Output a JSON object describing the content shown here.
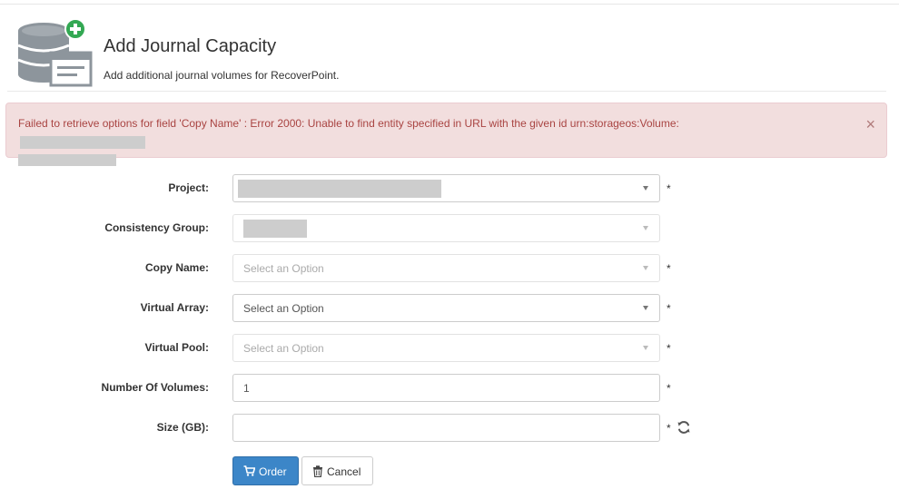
{
  "header": {
    "title": "Add Journal Capacity",
    "subtitle": "Add additional journal volumes for RecoverPoint.",
    "icon": "storage-add-icon"
  },
  "alert": {
    "message_part1": "Failed to retrieve options for field 'Copy Name' : Error 2000: Unable to find entity specified in URL with the given id urn:storageos:Volume:",
    "close_label": "×"
  },
  "form": {
    "project": {
      "label": "Project:",
      "required": "*"
    },
    "consistency_group": {
      "label": "Consistency Group:"
    },
    "copy_name": {
      "label": "Copy Name:",
      "placeholder": "Select an Option",
      "required": "*"
    },
    "virtual_array": {
      "label": "Virtual Array:",
      "value": "Select an Option",
      "required": "*"
    },
    "virtual_pool": {
      "label": "Virtual Pool:",
      "placeholder": "Select an Option",
      "required": "*"
    },
    "number_of_volumes": {
      "label": "Number Of Volumes:",
      "value": "1",
      "required": "*"
    },
    "size": {
      "label": "Size (GB):",
      "value": "",
      "required": "*"
    }
  },
  "buttons": {
    "order_label": "Order",
    "cancel_label": "Cancel"
  },
  "colors": {
    "primary": "#3c86c8",
    "alert_bg": "#f2dede",
    "alert_text": "#a94442"
  }
}
